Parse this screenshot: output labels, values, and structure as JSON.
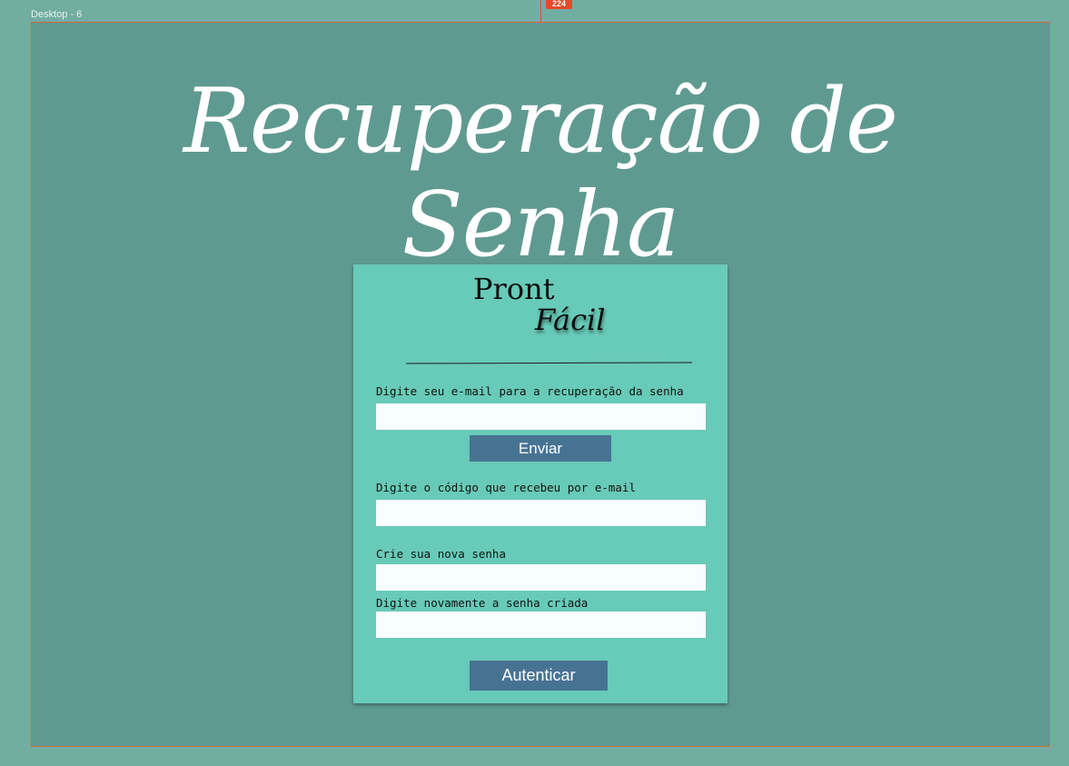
{
  "canvas": {
    "frame_label": "Desktop - 6",
    "marker_badge": "224",
    "marker_color": "#e8482a"
  },
  "page": {
    "title": "Recuperação de Senha",
    "background_color": "#5f9a90",
    "card_color": "#68cab8",
    "button_color": "#477393"
  },
  "logo": {
    "word1": "Pront",
    "word2": "Fácil"
  },
  "form": {
    "email_label": "Digite seu e-mail para a recuperação da senha",
    "email_value": "",
    "send_button": "Enviar",
    "code_label": "Digite o código que recebeu por e-mail",
    "code_value": "",
    "new_password_label": "Crie sua nova senha",
    "new_password_value": "",
    "confirm_password_label": "Digite novamente a senha criada",
    "confirm_password_value": "",
    "auth_button": "Autenticar"
  }
}
